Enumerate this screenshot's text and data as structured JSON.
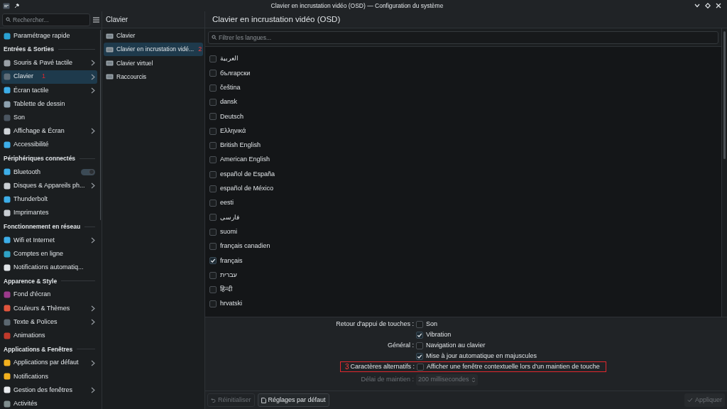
{
  "window": {
    "title": "Clavier en incrustation vidéo (OSD) — Configuration du système"
  },
  "sidebar": {
    "search": {
      "placeholder": "Rechercher..."
    },
    "items": [
      {
        "kind": "item",
        "label": "Paramétrage rapide",
        "selected": false,
        "has_children": false
      },
      {
        "kind": "section",
        "label": "Entrées & Sorties"
      },
      {
        "kind": "item",
        "label": "Souris & Pavé tactile",
        "selected": false,
        "has_children": true
      },
      {
        "kind": "item",
        "label": "Clavier",
        "selected": true,
        "has_children": true,
        "annotation": "1"
      },
      {
        "kind": "item",
        "label": "Écran tactile",
        "selected": false,
        "has_children": true
      },
      {
        "kind": "item",
        "label": "Tablette de dessin",
        "selected": false,
        "has_children": false
      },
      {
        "kind": "item",
        "label": "Son",
        "selected": false,
        "has_children": false
      },
      {
        "kind": "item",
        "label": "Affichage & Écran",
        "selected": false,
        "has_children": true
      },
      {
        "kind": "item",
        "label": "Accessibilité",
        "selected": false,
        "has_children": false
      },
      {
        "kind": "section",
        "label": "Périphériques connectés"
      },
      {
        "kind": "item",
        "label": "Bluetooth",
        "selected": false,
        "has_children": false,
        "toggle": true
      },
      {
        "kind": "item",
        "label": "Disques & Appareils ph...",
        "selected": false,
        "has_children": true
      },
      {
        "kind": "item",
        "label": "Thunderbolt",
        "selected": false,
        "has_children": false
      },
      {
        "kind": "item",
        "label": "Imprimantes",
        "selected": false,
        "has_children": false
      },
      {
        "kind": "section",
        "label": "Fonctionnement en réseau"
      },
      {
        "kind": "item",
        "label": "Wifi et Internet",
        "selected": false,
        "has_children": true
      },
      {
        "kind": "item",
        "label": "Comptes en ligne",
        "selected": false,
        "has_children": false
      },
      {
        "kind": "item",
        "label": "Notifications automatiq...",
        "selected": false,
        "has_children": false
      },
      {
        "kind": "section",
        "label": "Apparence & Style"
      },
      {
        "kind": "item",
        "label": "Fond d'écran",
        "selected": false,
        "has_children": false
      },
      {
        "kind": "item",
        "label": "Couleurs & Thèmes",
        "selected": false,
        "has_children": true
      },
      {
        "kind": "item",
        "label": "Texte & Polices",
        "selected": false,
        "has_children": true
      },
      {
        "kind": "item",
        "label": "Animations",
        "selected": false,
        "has_children": false
      },
      {
        "kind": "section",
        "label": "Applications & Fenêtres"
      },
      {
        "kind": "item",
        "label": "Applications par défaut",
        "selected": false,
        "has_children": true
      },
      {
        "kind": "item",
        "label": "Notifications",
        "selected": false,
        "has_children": false
      },
      {
        "kind": "item",
        "label": "Gestion des fenêtres",
        "selected": false,
        "has_children": true
      },
      {
        "kind": "item",
        "label": "Activités",
        "selected": false,
        "has_children": false
      }
    ]
  },
  "subpanel": {
    "title": "Clavier",
    "items": [
      {
        "label": "Clavier",
        "selected": false
      },
      {
        "label": "Clavier en incrustation vidé...",
        "selected": true,
        "annotation": "2"
      },
      {
        "label": "Clavier virtuel",
        "selected": false
      },
      {
        "label": "Raccourcis",
        "selected": false
      }
    ]
  },
  "page": {
    "title": "Clavier en incrustation vidéo (OSD)",
    "filter": {
      "placeholder": "Filtrer les langues..."
    },
    "languages": [
      {
        "label": "العربية",
        "checked": false
      },
      {
        "label": "български",
        "checked": false
      },
      {
        "label": "čeština",
        "checked": false
      },
      {
        "label": "dansk",
        "checked": false
      },
      {
        "label": "Deutsch",
        "checked": false
      },
      {
        "label": "Ελληνικά",
        "checked": false
      },
      {
        "label": "British English",
        "checked": false
      },
      {
        "label": "American English",
        "checked": false
      },
      {
        "label": "español de España",
        "checked": false
      },
      {
        "label": "español de México",
        "checked": false
      },
      {
        "label": "eesti",
        "checked": false
      },
      {
        "label": "فارسی",
        "checked": false
      },
      {
        "label": "suomi",
        "checked": false
      },
      {
        "label": "français canadien",
        "checked": false
      },
      {
        "label": "français",
        "checked": true
      },
      {
        "label": "עברית",
        "checked": false
      },
      {
        "label": "हिन्दी",
        "checked": false
      },
      {
        "label": "hrvatski",
        "checked": false
      }
    ],
    "settings": [
      {
        "kind": "checkbox",
        "label": "Retour d'appui de touches :",
        "option": "Son",
        "checked": false,
        "highlighted": false
      },
      {
        "kind": "checkbox",
        "option": "Vibration",
        "checked": true,
        "highlighted": false
      },
      {
        "kind": "checkbox",
        "label": "Général :",
        "option": "Navigation au clavier",
        "checked": false,
        "highlighted": false
      },
      {
        "kind": "checkbox",
        "option": "Mise à jour automatique en majuscules",
        "checked": true,
        "highlighted": false
      },
      {
        "kind": "checkbox",
        "label": "Caractères alternatifs :",
        "option": "Afficher une fenêtre contextuelle lors d'un maintien de touche",
        "checked": false,
        "highlighted": true,
        "annotation": "3"
      },
      {
        "kind": "spinbox",
        "label": "Délai de maintien :",
        "value": "200 millisecondes",
        "disabled": true
      }
    ]
  },
  "footer": {
    "reset": {
      "label": "Réinitialiser",
      "disabled": true
    },
    "defaults": {
      "label": "Réglages par défaut"
    },
    "apply": {
      "label": "Appliquer",
      "disabled": true
    }
  }
}
